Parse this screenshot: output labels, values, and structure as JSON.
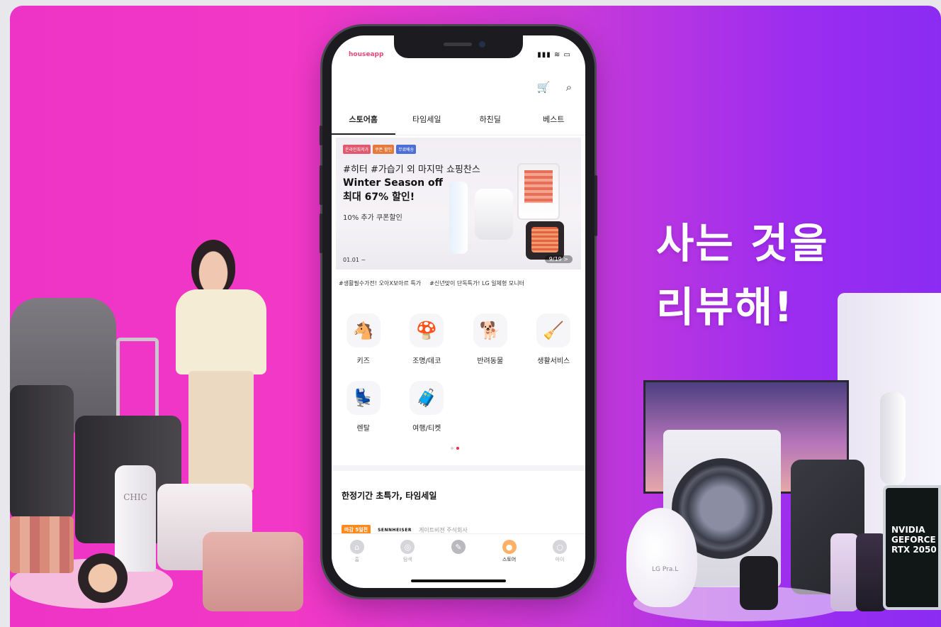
{
  "headline": {
    "line1": "사는 것을",
    "line2": "리뷰해!"
  },
  "decor": {
    "bottle_label": "CHIC",
    "hairdryer_label": "LG Pra.L",
    "laptop_line1": "NVIDIA",
    "laptop_line2": "GEFORCE",
    "laptop_line3": "RTX 2050"
  },
  "phone": {
    "app_logo": "houseapp",
    "status_icons": "▮▮▮ ≋ ▭",
    "top_icons": {
      "cart": "🛒",
      "search": "⌕"
    },
    "tabs": [
      {
        "label": "스토어홈",
        "active": true
      },
      {
        "label": "타임세일"
      },
      {
        "label": "하친딜"
      },
      {
        "label": "베스트"
      }
    ],
    "banner": {
      "tags": [
        {
          "label": "온라인최저가",
          "color": "#e0596e"
        },
        {
          "label": "쿠폰 할인",
          "color": "#e47b3d"
        },
        {
          "label": "무료배송",
          "color": "#4c6fd6"
        }
      ],
      "hash_line": "#히터 #가습기 외 마지막 쇼핑찬스",
      "title_line1": "Winter Season off",
      "title_line2": "최대 67% 할인!",
      "subtitle": "10% 추가 쿠폰할인",
      "date": "01.01 ~",
      "counter": "9/19 >"
    },
    "hashtags": [
      "#생활필수가전! 오아X보아르 특가",
      "#신년맞이 단독특가! LG 일체형 모니터"
    ],
    "categories": [
      {
        "label": "키즈",
        "icon": "🐴"
      },
      {
        "label": "조명/데코",
        "icon": "🍄"
      },
      {
        "label": "반려동물",
        "icon": "🐕"
      },
      {
        "label": "생활서비스",
        "icon": "🧹"
      },
      {
        "label": "렌탈",
        "icon": "💺"
      },
      {
        "label": "여행/티켓",
        "icon": "🧳"
      }
    ],
    "section_title": "한정기간 초특가, 타임세일",
    "deal": {
      "badge": "마감 5일전",
      "brand": "SENNHEISER",
      "seller": "게이트비젼 주식회사"
    },
    "bottom_nav": [
      {
        "label": "홈",
        "icon": "⌂"
      },
      {
        "label": "탐색",
        "icon": "◎"
      },
      {
        "label": "",
        "icon": "✎",
        "pen": true
      },
      {
        "label": "스토어",
        "icon": "●",
        "active": true
      },
      {
        "label": "마이",
        "icon": "○"
      }
    ]
  }
}
